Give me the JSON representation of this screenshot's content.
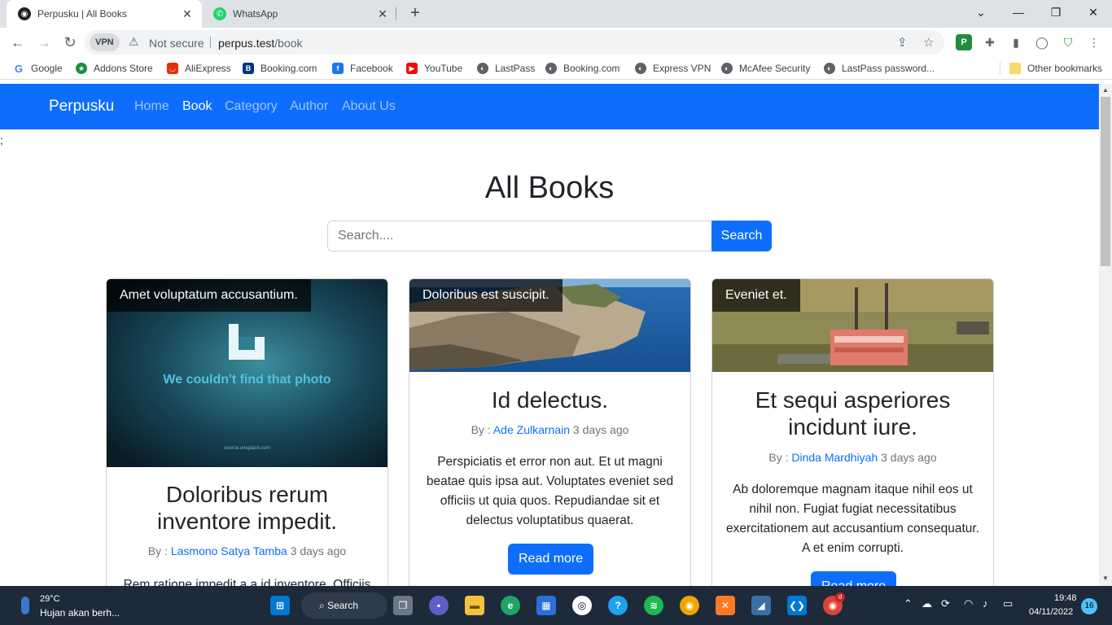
{
  "browser": {
    "tabs": [
      {
        "title": "Perpusku | All Books",
        "icon": "globe-icon",
        "active": true
      },
      {
        "title": "WhatsApp",
        "icon": "whatsapp-icon",
        "active": false
      }
    ],
    "address": {
      "vpn_label": "VPN",
      "security": "Not secure",
      "host": "perpus.test",
      "path": "/book"
    },
    "bookmarks": [
      {
        "label": "Google",
        "icon": "google-icon",
        "color": "#4285f4"
      },
      {
        "label": "Addons Store",
        "icon": "addons-icon",
        "color": "#1e8e3e"
      },
      {
        "label": "AliExpress",
        "icon": "aliexpress-icon",
        "color": "#e62e04"
      },
      {
        "label": "Booking.com",
        "icon": "booking-icon",
        "color": "#003580"
      },
      {
        "label": "Facebook",
        "icon": "facebook-icon",
        "color": "#1877f2"
      },
      {
        "label": "YouTube",
        "icon": "youtube-icon",
        "color": "#ff0000"
      },
      {
        "label": "LastPass",
        "icon": "globe-icon",
        "color": "#5f6368"
      },
      {
        "label": "Booking.com",
        "icon": "globe-icon",
        "color": "#5f6368"
      },
      {
        "label": "Express VPN",
        "icon": "globe-icon",
        "color": "#5f6368"
      },
      {
        "label": "McAfee Security",
        "icon": "globe-icon",
        "color": "#5f6368"
      },
      {
        "label": "LastPass password...",
        "icon": "globe-icon",
        "color": "#5f6368"
      }
    ],
    "other_bookmarks": "Other bookmarks"
  },
  "app": {
    "brand": "Perpusku",
    "nav": [
      {
        "label": "Home",
        "active": false
      },
      {
        "label": "Book",
        "active": true
      },
      {
        "label": "Category",
        "active": false
      },
      {
        "label": "Author",
        "active": false
      },
      {
        "label": "About Us",
        "active": false
      }
    ],
    "stray_text": ";",
    "page_title": "All Books",
    "search": {
      "placeholder": "Search....",
      "button": "Search"
    },
    "accent_color": "#0d6efd"
  },
  "books": [
    {
      "category": "Amet voluptatum accusantium.",
      "image_caption": "We couldn't find that photo",
      "image_source": "source.unsplash.com",
      "title": "Doloribus rerum inventore impedit.",
      "by": "By :",
      "author": "Lasmono Satya Tamba",
      "time": "3 days ago",
      "excerpt": "Rem ratione impedit a a id inventore. Officiis",
      "button": "Read more"
    },
    {
      "category": "Doloribus est suscipit.",
      "title": "Id delectus.",
      "by": "By :",
      "author": "Ade Zulkarnain",
      "time": "3 days ago",
      "excerpt": "Perspiciatis et error non aut. Et ut magni beatae quis ipsa aut. Voluptates eveniet sed officiis ut quia quos. Repudiandae sit et delectus voluptatibus quaerat.",
      "button": "Read more"
    },
    {
      "category": "Eveniet et.",
      "title": "Et sequi asperiores incidunt iure.",
      "by": "By :",
      "author": "Dinda Mardhiyah",
      "time": "3 days ago",
      "excerpt": "Ab doloremque magnam itaque nihil eos ut nihil non. Fugiat fugiat necessitatibus exercitationem aut accusantium consequatur. A et enim corrupti.",
      "button": "Read more"
    }
  ],
  "taskbar": {
    "weather_temp": "29°C",
    "weather_desc": "Hujan akan berh...",
    "search_label": "Search",
    "time": "19:48",
    "date": "04/11/2022",
    "notifications": "16",
    "chrome_badge": "d"
  }
}
